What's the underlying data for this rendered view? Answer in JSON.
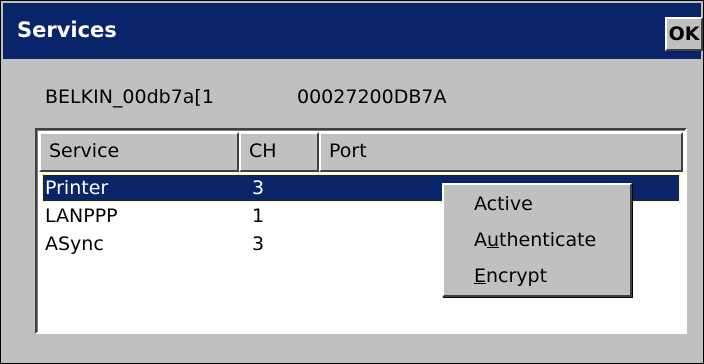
{
  "window": {
    "title": "Services",
    "ok_label": "OK"
  },
  "device": {
    "name": "BELKIN_00db7a[1",
    "address": "00027200DB7A"
  },
  "table": {
    "columns": [
      "Service",
      "CH",
      "Port"
    ],
    "rows": [
      {
        "service": "Printer",
        "ch": "3",
        "port": "",
        "selected": true
      },
      {
        "service": "LANPPP",
        "ch": "1",
        "port": "",
        "selected": false
      },
      {
        "service": "ASync",
        "ch": "3",
        "port": "",
        "selected": false
      }
    ]
  },
  "context_menu": {
    "items": [
      {
        "label": "Active",
        "underline_index": -1
      },
      {
        "label": "Authenticate",
        "underline_index": 1
      },
      {
        "label": "Encrypt",
        "underline_index": 0
      }
    ]
  },
  "colors": {
    "titlebar": "#0a246a",
    "selection": "#0a246a",
    "face": "#c0c0c0"
  }
}
